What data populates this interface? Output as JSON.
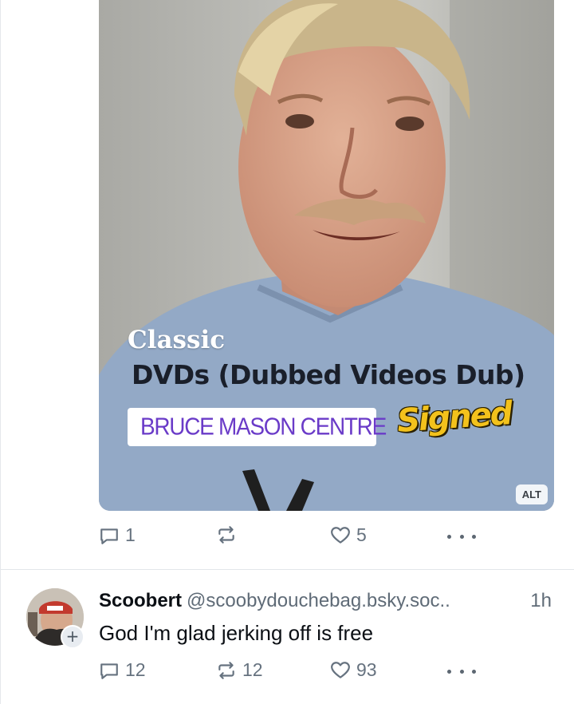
{
  "media": {
    "overlay_title": "Classic",
    "overlay_subtitle": "DVDs (Dubbed Videos Dub)",
    "location_tag": "BRUCE MASON CENTRE",
    "sticker": "Signed",
    "alt_badge": "ALT",
    "colors": {
      "location_text": "#6a3bc8",
      "sticker": "#f3c21c"
    }
  },
  "first_post_actions": {
    "reply_count": "1",
    "repost_count": "",
    "like_count": "5",
    "icons": [
      "reply-icon",
      "repost-icon",
      "heart-icon",
      "more-icon"
    ]
  },
  "reply_post": {
    "display_name": "Scoobert",
    "handle": "@scoobydouchebag.bsky.soc..",
    "time": "1h",
    "text": "God I'm glad jerking off is free",
    "follow_icon": "+",
    "reply_count": "12",
    "repost_count": "12",
    "like_count": "93"
  }
}
